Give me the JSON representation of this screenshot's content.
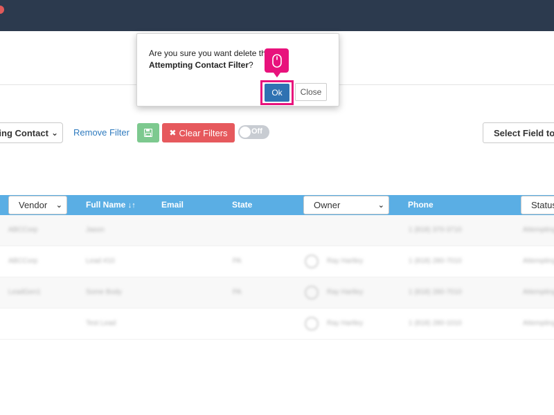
{
  "filters": {
    "selected_filter": "Attempting Contact",
    "remove_filter_label": "Remove Filter",
    "clear_filters_label": "Clear Filters",
    "toggle_label": "Off",
    "select_field_label": "Select Field to"
  },
  "table": {
    "headers": {
      "vendor": "Vendor",
      "full_name": "Full Name",
      "sort_glyph": "↓↑",
      "email": "Email",
      "state": "State",
      "owner": "Owner",
      "phone": "Phone",
      "status": "Status"
    },
    "rows": [
      {
        "vendor": "ABCCorp",
        "name": "Jason",
        "state": "",
        "owner": "",
        "phone": "1 (818) 370-3710",
        "status": "Attempting"
      },
      {
        "vendor": "ABCCorp",
        "name": "Lead #10",
        "state": "PA",
        "owner": "Ray Hartley",
        "phone": "1 (818) 280-7010",
        "status": "Attempting"
      },
      {
        "vendor": "LeadGen1",
        "name": "Some Body",
        "state": "PA",
        "owner": "Ray Hartley",
        "phone": "1 (818) 280-7010",
        "status": "Attempting"
      },
      {
        "vendor": "",
        "name": "Test Lead",
        "state": "",
        "owner": "Ray Hartley",
        "phone": "1 (818) 280-1010",
        "status": "Attempting"
      }
    ]
  },
  "modal": {
    "message_prefix": "Are you sure you want delete the filter",
    "filter_name": "Attempting Contact Filter",
    "message_suffix": "?",
    "ok_label": "Ok",
    "close_label": "Close"
  },
  "colors": {
    "topbar": "#2c3a4e",
    "table_header": "#5aaee4",
    "clear_button": "#e6595d",
    "save_button": "#7dc98f",
    "ok_button": "#2f72b2",
    "highlight": "#e8127c"
  }
}
